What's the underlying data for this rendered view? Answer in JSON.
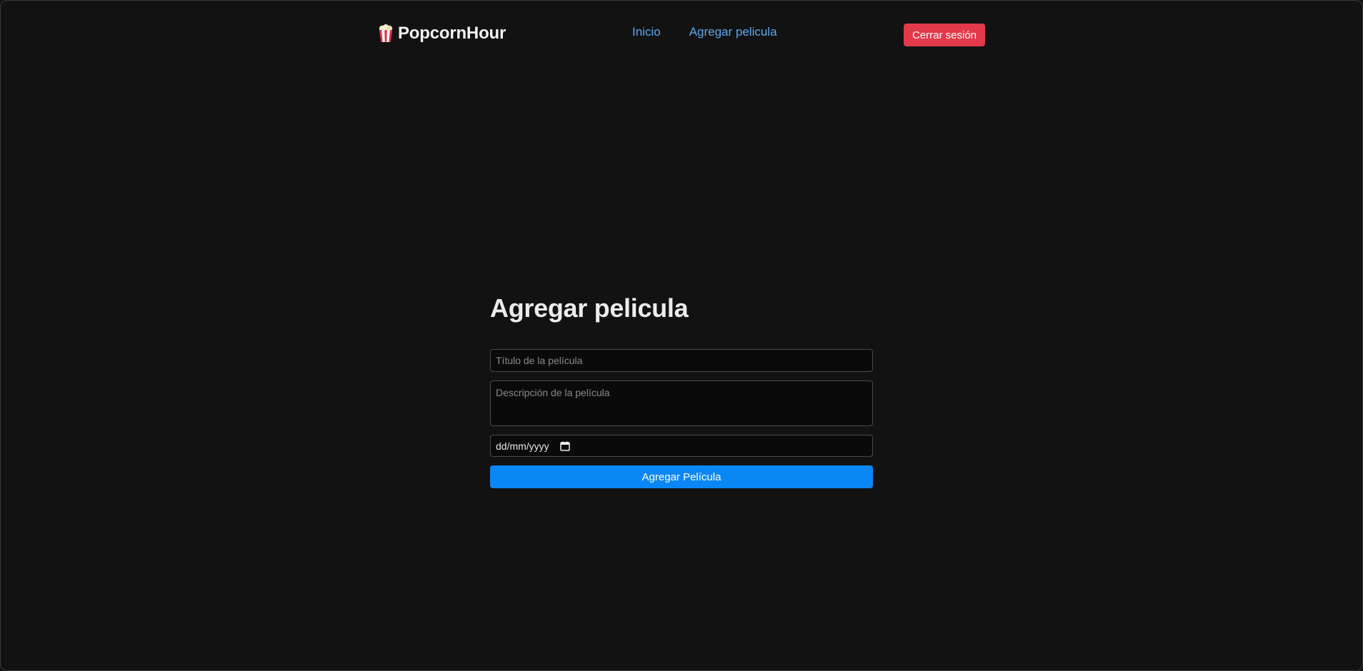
{
  "app": {
    "brand_name": "PopcornHour",
    "brand_icon": "popcorn-icon"
  },
  "nav": {
    "items": [
      {
        "label": "Inicio"
      },
      {
        "label": "Agregar pelicula"
      }
    ],
    "logout_label": "Cerrar sesión"
  },
  "form": {
    "title": "Agregar pelicula",
    "title_placeholder": "Título de la película",
    "title_value": "",
    "description_placeholder": "Descripción de la película",
    "description_value": "",
    "date_format": "dd/mm/yyyy",
    "date_icon": "calendar-icon",
    "submit_label": "Agregar Película"
  },
  "colors": {
    "background": "#121212",
    "link": "#5aa9f0",
    "logout": "#e23a4b",
    "primary": "#0a87f5"
  }
}
